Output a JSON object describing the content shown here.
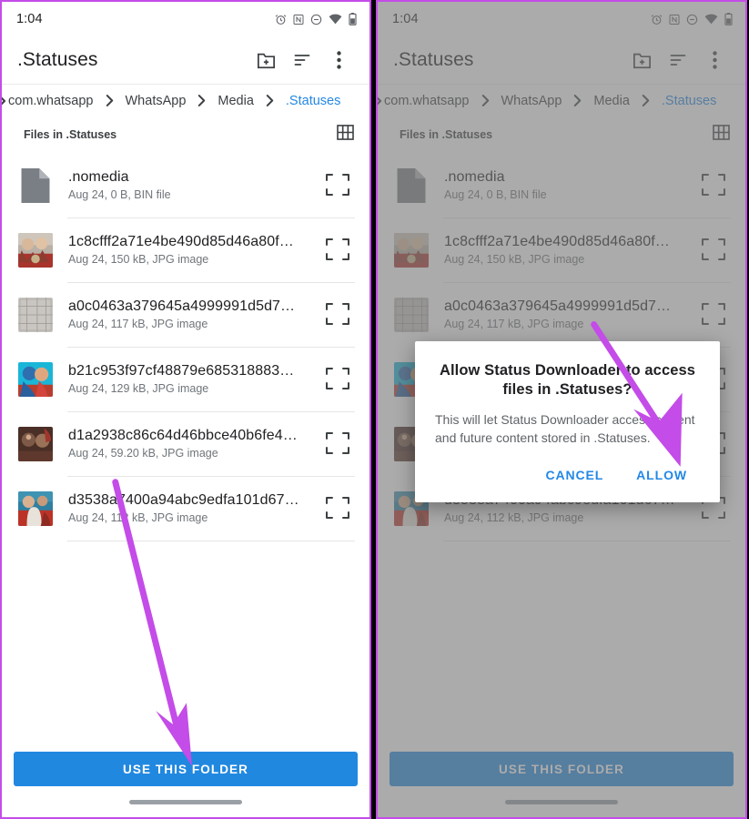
{
  "colors": {
    "accent_blue": "#2188E0",
    "link_blue": "#2388E5",
    "annotation_purple": "#C44CE8",
    "panel_border": "#C44CE8",
    "text_primary": "#202124",
    "text_secondary": "#70757a"
  },
  "status_bar": {
    "time": "1:04",
    "icons": [
      "alarm-icon",
      "nfc-icon",
      "do-not-disturb-icon",
      "wifi-icon",
      "battery-icon"
    ]
  },
  "toolbar": {
    "title": ".Statuses",
    "actions": [
      {
        "name": "create-folder-icon",
        "label": "Create new folder"
      },
      {
        "name": "sort-icon",
        "label": "Sort"
      },
      {
        "name": "overflow-menu-icon",
        "label": "More options"
      }
    ]
  },
  "breadcrumb": {
    "lead_icon": "chevron-right-icon",
    "items": [
      {
        "label": "com.whatsapp",
        "active": false
      },
      {
        "label": "WhatsApp",
        "active": false
      },
      {
        "label": "Media",
        "active": false
      },
      {
        "label": ".Statuses",
        "active": true
      }
    ]
  },
  "section": {
    "label": "Files in .Statuses",
    "view_toggle_icon": "grid-view-icon"
  },
  "files": [
    {
      "name": ".nomedia",
      "sub": "Aug 24, 0 B, BIN file",
      "thumb": "document-icon",
      "action_icon": "expand-icon"
    },
    {
      "name": "1c8cfff2a71e4be490d85d46a80f…",
      "sub": "Aug 24, 150 kB, JPG image",
      "thumb": "image-thumbnail",
      "action_icon": "expand-icon"
    },
    {
      "name": "a0c0463a379645a4999991d5d7…",
      "sub": "Aug 24, 117 kB, JPG image",
      "thumb": "image-thumbnail",
      "action_icon": "expand-icon"
    },
    {
      "name": "b21c953f97cf48879e685318883…",
      "sub": "Aug 24, 129 kB, JPG image",
      "thumb": "image-thumbnail",
      "action_icon": "expand-icon"
    },
    {
      "name": "d1a2938c86c64d46bbce40b6fe4…",
      "sub": "Aug 24, 59.20 kB, JPG image",
      "thumb": "image-thumbnail",
      "action_icon": "expand-icon"
    },
    {
      "name": "d3538a7400a94abc9edfa101d67…",
      "sub": "Aug 24, 112 kB, JPG image",
      "thumb": "image-thumbnail",
      "action_icon": "expand-icon"
    }
  ],
  "bottom": {
    "use_folder_label": "USE THIS FOLDER"
  },
  "dialog": {
    "title": "Allow Status Downloader to access files in .Statuses?",
    "body": "This will let Status Downloader access current and future content stored in .Statuses.",
    "cancel_label": "CANCEL",
    "allow_label": "ALLOW"
  },
  "annotations": [
    {
      "name": "arrow-to-use-this-folder",
      "panel": "left",
      "target": "use-this-folder-button"
    },
    {
      "name": "arrow-to-allow-button",
      "panel": "right",
      "target": "dialog-allow-button"
    }
  ]
}
